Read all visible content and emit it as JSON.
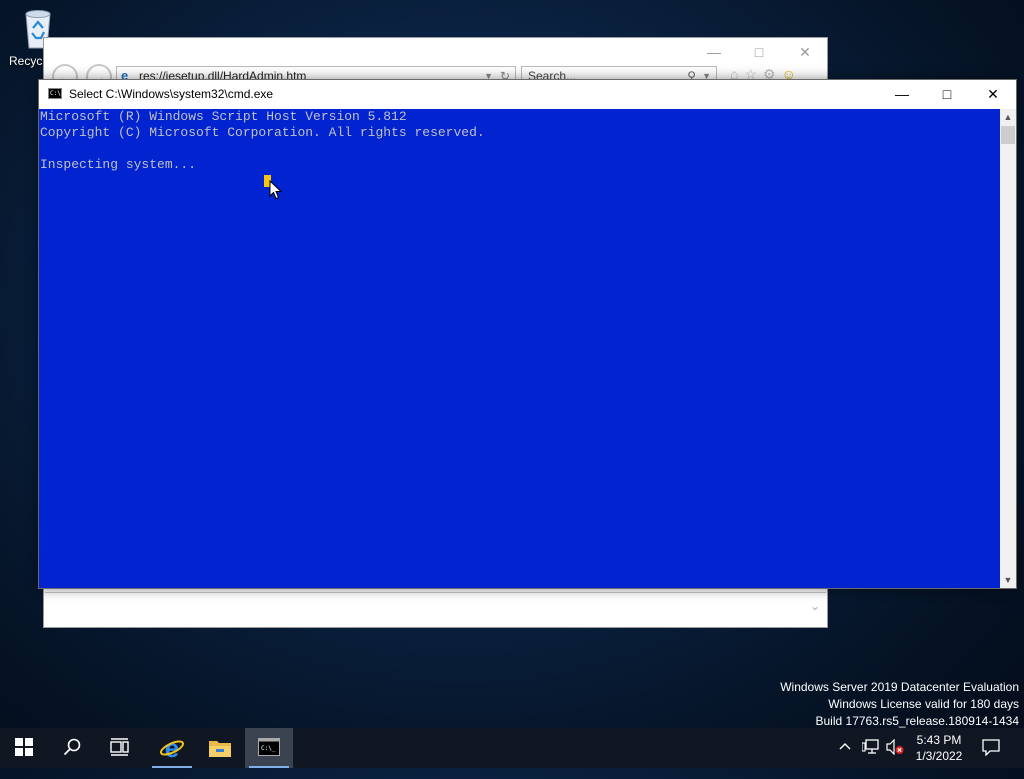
{
  "desktop": {
    "recycle_bin_label": "Recycl"
  },
  "ie_window": {
    "address": "res://iesetup.dll/HardAdmin.htm",
    "search_placeholder": "Search...",
    "minimize_icon": "minimize-icon",
    "maximize_icon": "maximize-icon",
    "close_icon": "close-icon"
  },
  "cmd_window": {
    "title": "Select C:\\Windows\\system32\\cmd.exe",
    "lines": [
      "Microsoft (R) Windows Script Host Version 5.812",
      "Copyright (C) Microsoft Corporation. All rights reserved.",
      "",
      "Inspecting system..."
    ],
    "background_color": "#0124d0",
    "text_color": "#c0c0c0",
    "selection_color": "#f5c518"
  },
  "watermark": {
    "line1": "Windows Server 2019 Datacenter Evaluation",
    "line2": "Windows License valid for 180 days",
    "line3": "Build 17763.rs5_release.180914-1434"
  },
  "taskbar": {
    "buttons": [
      "start-icon",
      "search-icon",
      "task-view-icon",
      "internet-explorer-icon",
      "file-explorer-icon",
      "command-prompt-icon"
    ],
    "tray_icons": [
      "chevron-up-icon",
      "network-icon",
      "volume-muted-icon",
      "action-center-icon"
    ],
    "time": "5:43 PM",
    "date": "1/3/2022"
  }
}
